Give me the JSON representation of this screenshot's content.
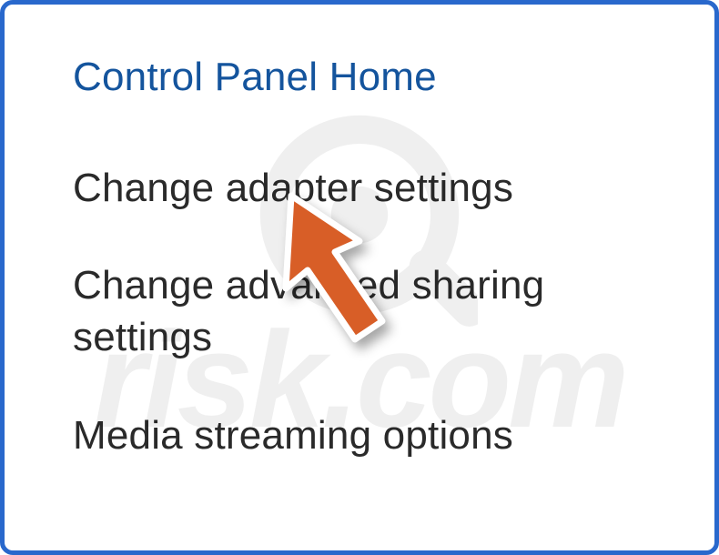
{
  "sidebar": {
    "heading": "Control Panel Home",
    "links": {
      "adapter": "Change adapter settings",
      "sharing": "Change advanced sharing settings",
      "media": "Media streaming options"
    }
  },
  "cursor": {
    "color": "#d85e27",
    "stroke": "#ffffff"
  }
}
